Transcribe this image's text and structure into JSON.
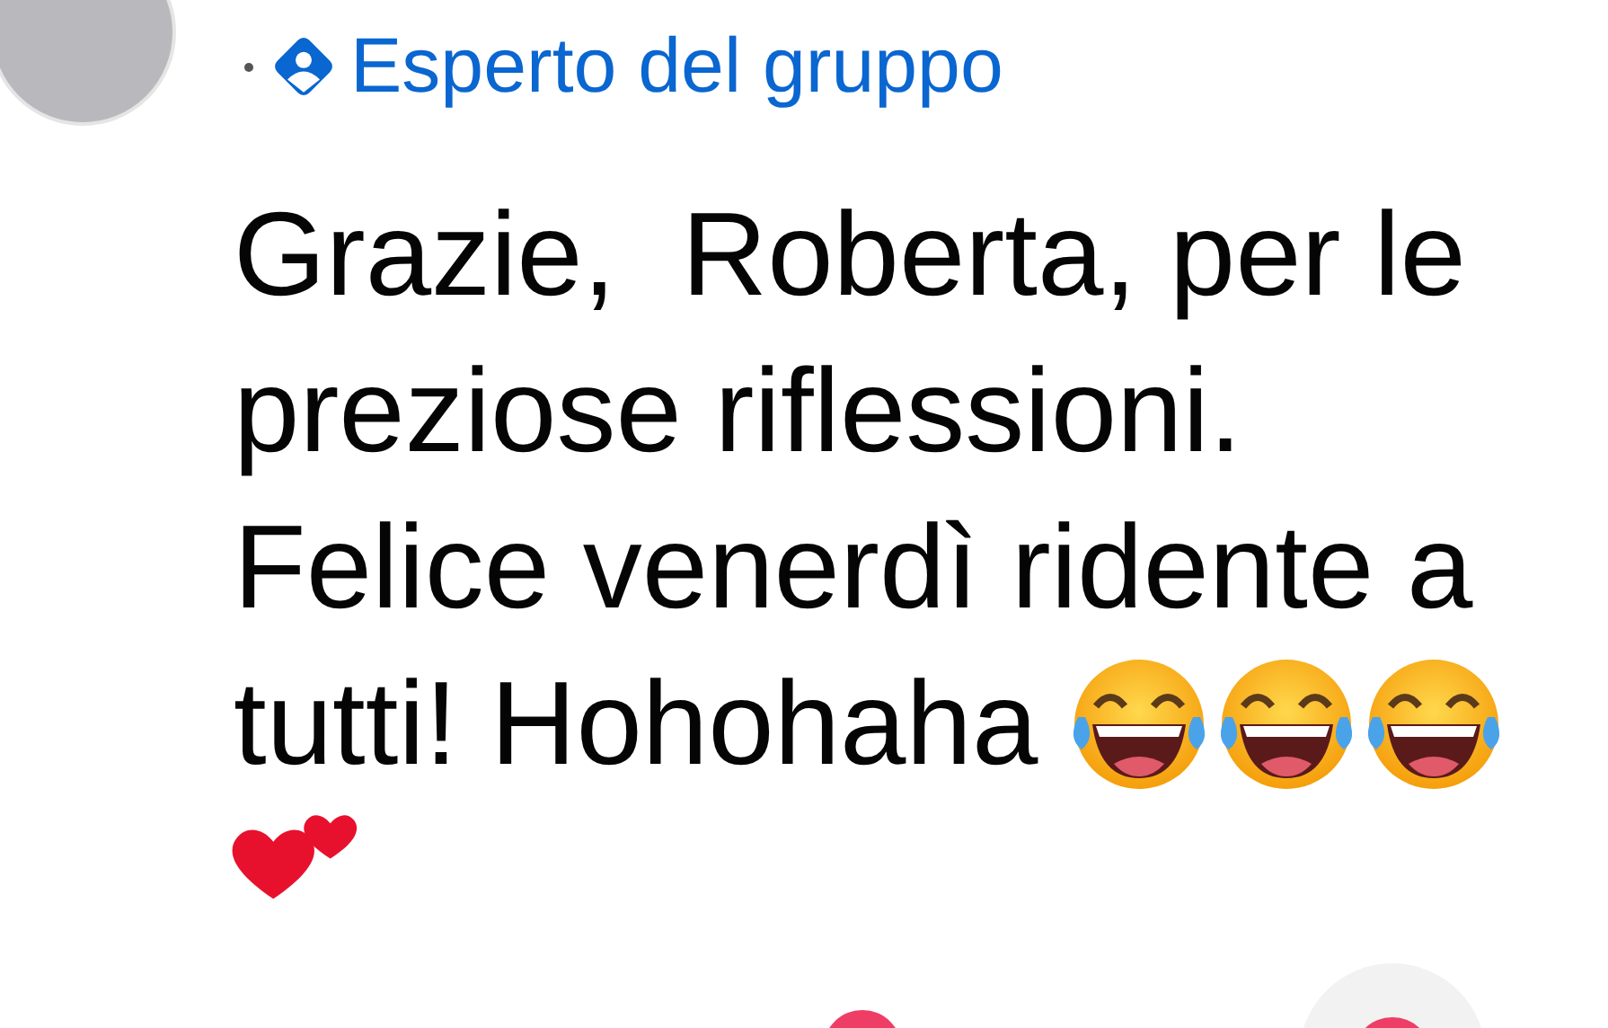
{
  "badge": {
    "label": "Esperto del gruppo"
  },
  "comment": {
    "lines": [
      "Grazie,  Roberta, per le",
      "preziose riflessioni.",
      "Felice venerdì ridente a",
      "tutti! Hohohaha"
    ]
  }
}
